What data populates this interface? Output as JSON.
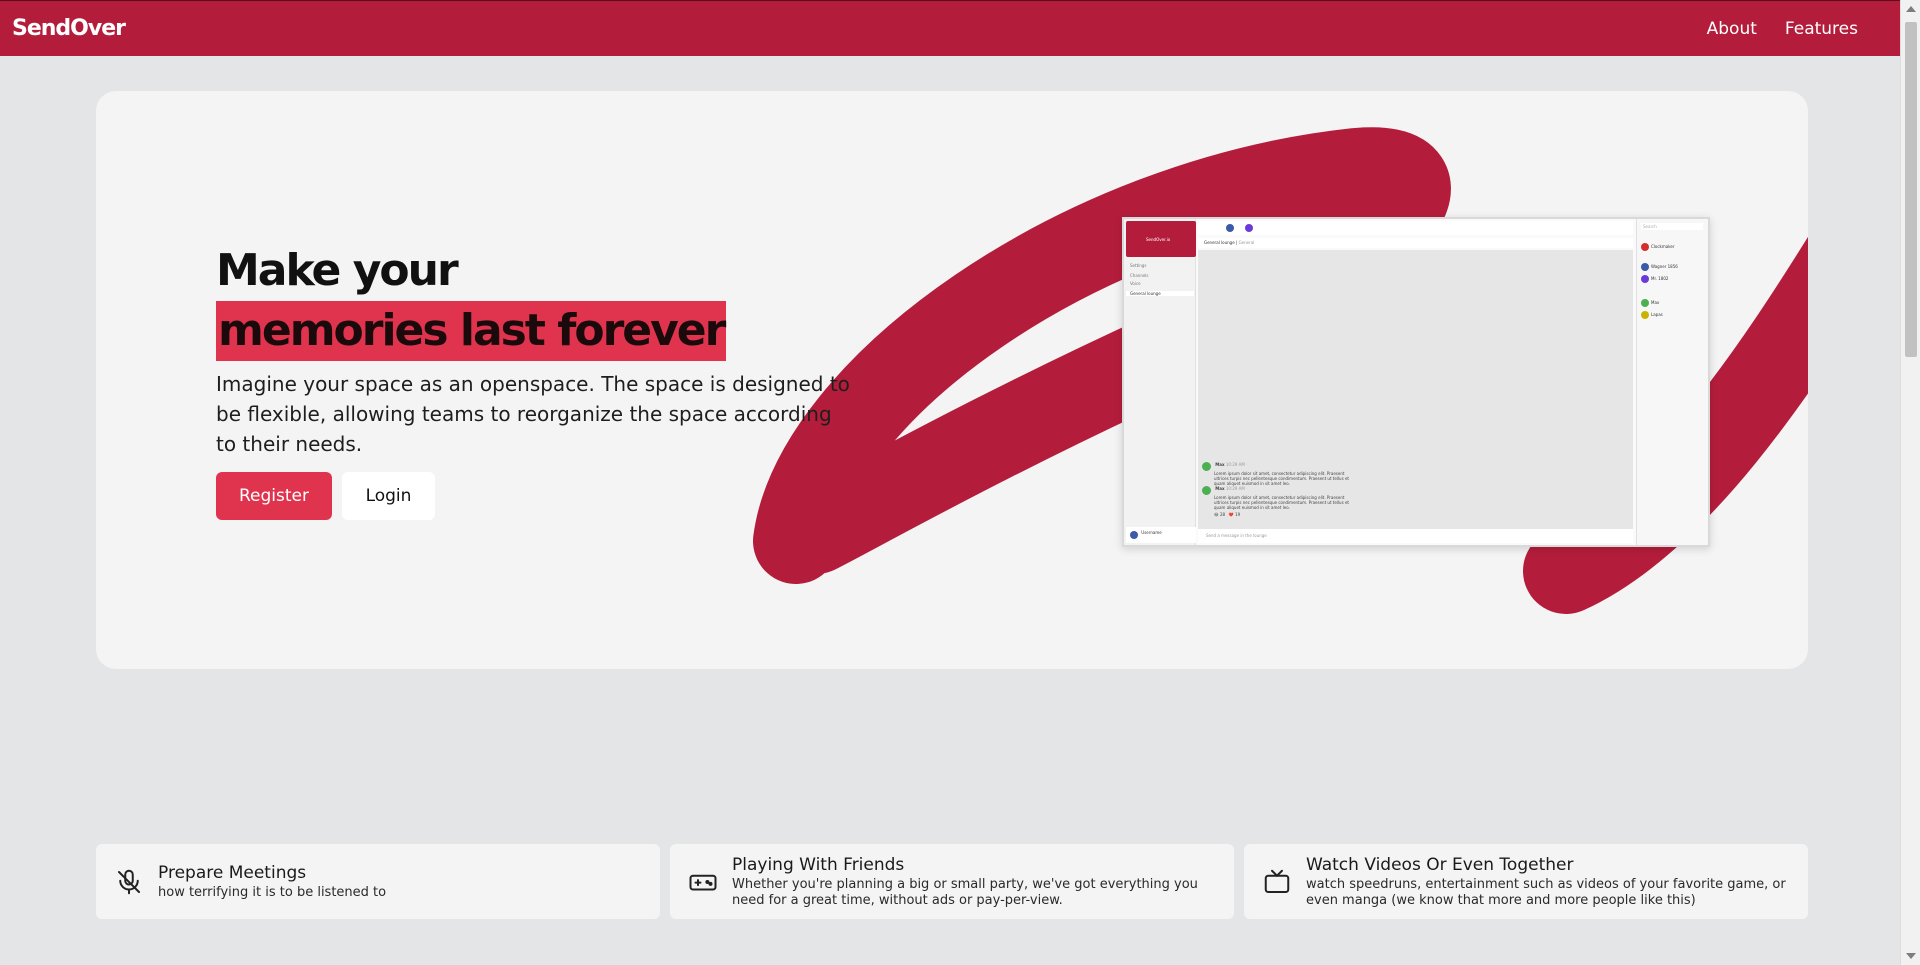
{
  "header": {
    "logo": "SendOver",
    "nav": [
      "About",
      "Features"
    ],
    "accent": "#b31d3b"
  },
  "hero": {
    "title_line1": "Make your",
    "title_line2": "memories last forever",
    "subtitle": "Imagine your space as an openspace. The space is designed to be flexible, allowing teams to reorganize the space according to their needs.",
    "register_label": "Register",
    "login_label": "Login",
    "button_color": "#e0344e"
  },
  "preview": {
    "server_name": "SendOver.io",
    "channel": "General lounge",
    "channel_tag": "General",
    "sidebar_items": [
      "Settings",
      "Channels",
      "Voice",
      "General lounge"
    ],
    "username": "Username",
    "messages": [
      {
        "author": "Max",
        "time": "10:29 AM",
        "text": "Lorem ipsum dolor sit amet, consectetur adipiscing elit. Praesent ultrices turpis nec pellentesque condimentum. Praesent ut tellus et quam aliquet euismod in sit amet leo."
      },
      {
        "author": "Max",
        "time": "10:29 AM",
        "text": "Lorem ipsum dolor sit amet, consectetur adipiscing elit. Praesent ultrices turpis nec pellentesque condimentum. Praesent ut tellus et quam aliquet euismod in sit amet leo."
      }
    ],
    "reactions": [
      "😂 28",
      "❤️ 19"
    ],
    "input_placeholder": "Send a message in the lounge",
    "search_placeholder": "Search",
    "members": [
      "Clockmaker",
      "Wagner 1856",
      "Mr. 1802",
      "Max",
      "Lapas"
    ]
  },
  "features": [
    {
      "icon": "microphone-off-icon",
      "title": "Prepare Meetings",
      "desc": "how terrifying it is to be listened to"
    },
    {
      "icon": "gamepad-icon",
      "title": "Playing With Friends",
      "desc": "Whether you're planning a big or small party, we've got everything you need for a great time, without ads or pay-per-view."
    },
    {
      "icon": "tv-icon",
      "title": "Watch Videos Or Even Together",
      "desc": "watch speedruns, entertainment such as videos of your favorite game, or even manga (we know that more and more people like this)"
    }
  ]
}
